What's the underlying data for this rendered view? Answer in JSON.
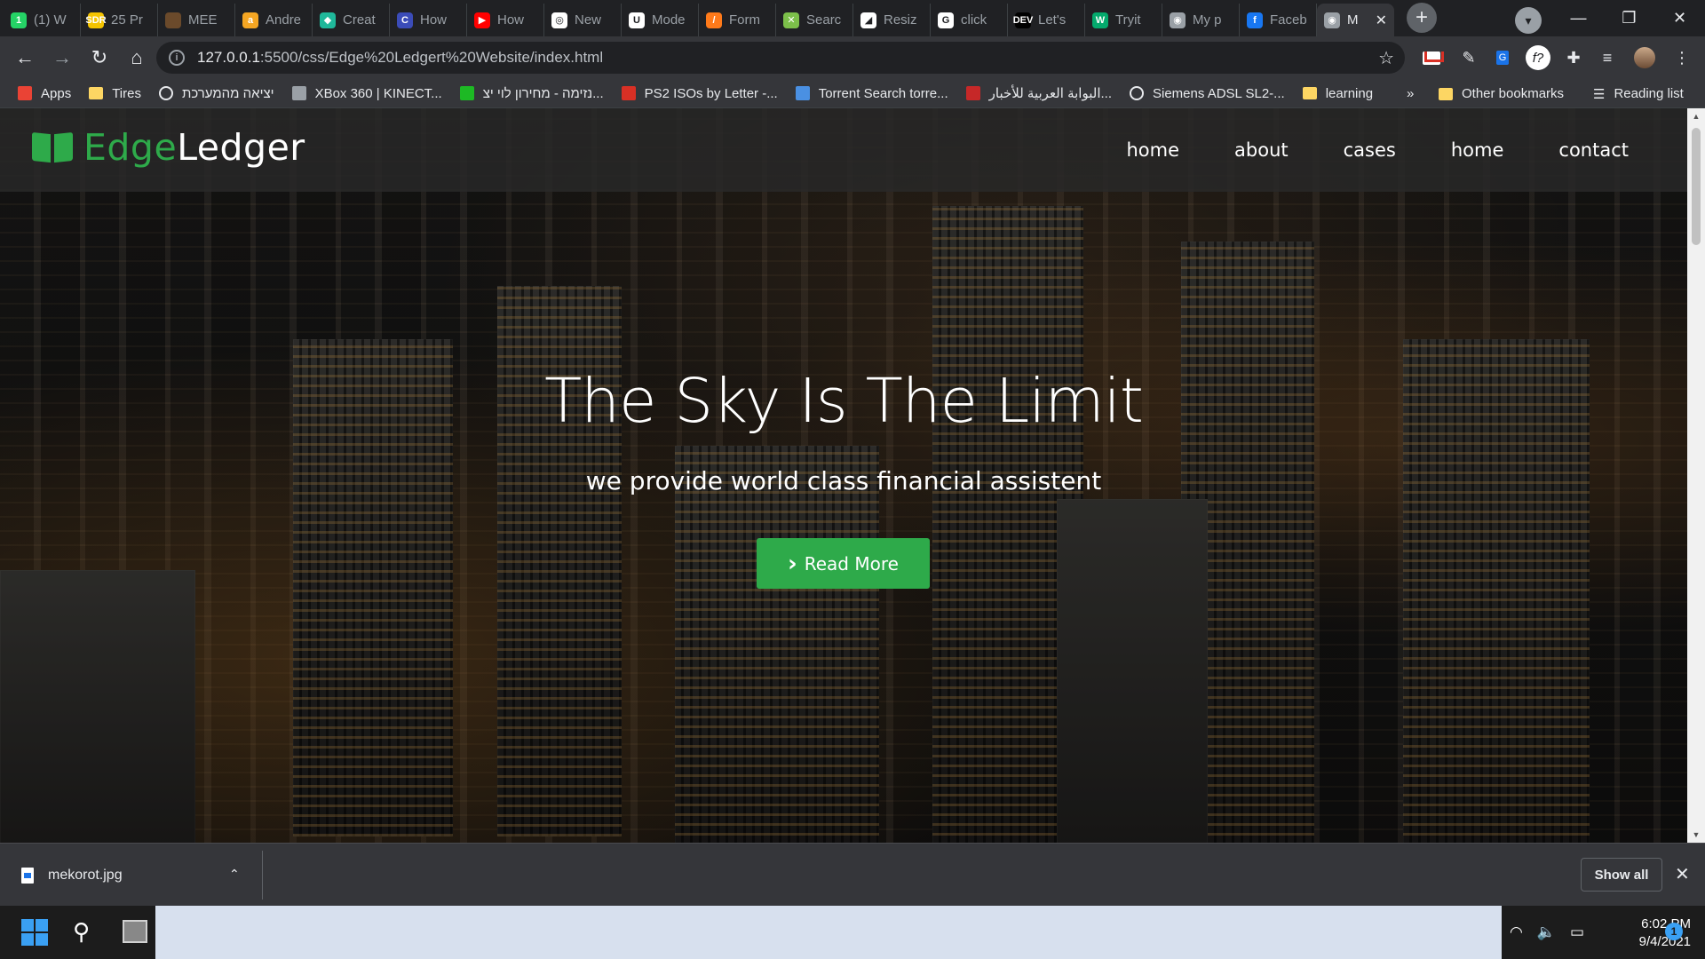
{
  "browser": {
    "tabs": [
      {
        "title": "(1) W",
        "color": "#25d366",
        "glyph": "1"
      },
      {
        "title": "25 Pr",
        "color": "#f5c400",
        "glyph": "SDR"
      },
      {
        "title": "MEE",
        "color": "#6b4a2b",
        "glyph": ""
      },
      {
        "title": "Andre",
        "color": "#f5a623",
        "glyph": "a"
      },
      {
        "title": "Creat",
        "color": "#1fb89a",
        "glyph": "◆"
      },
      {
        "title": "How",
        "color": "#3b4cb8",
        "glyph": "C"
      },
      {
        "title": "How",
        "color": "#ff0000",
        "glyph": "▶"
      },
      {
        "title": "New",
        "color": "#ffffff",
        "glyph": "◎"
      },
      {
        "title": "Mode",
        "color": "#ffffff",
        "glyph": "U"
      },
      {
        "title": "Form",
        "color": "#ff7a1a",
        "glyph": "/"
      },
      {
        "title": "Searc",
        "color": "#7cbf4a",
        "glyph": "✕"
      },
      {
        "title": "Resiz",
        "color": "#ffffff",
        "glyph": "◢"
      },
      {
        "title": "click",
        "color": "#ffffff",
        "glyph": "G"
      },
      {
        "title": "Let's",
        "color": "#000000",
        "glyph": "DEV"
      },
      {
        "title": "Tryit",
        "color": "#04aa6d",
        "glyph": "W"
      },
      {
        "title": "My p",
        "color": "#9aa0a6",
        "glyph": "◉"
      },
      {
        "title": "Faceb",
        "color": "#1877f2",
        "glyph": "f"
      },
      {
        "title": "M",
        "color": "#9aa0a6",
        "glyph": "◉",
        "active": true
      }
    ],
    "new_tab_glyph": "+",
    "window_controls": {
      "minimize": "—",
      "restore": "❐",
      "close": "✕"
    },
    "url": {
      "host": "127.0.0.1",
      "path": ":5500/css/Edge%20Ledgert%20Website/index.html"
    },
    "nav": {
      "back": "←",
      "forward": "→",
      "reload": "↻",
      "home": "⌂"
    },
    "bookmarks": [
      {
        "label": "Apps",
        "icon": "apps-icon",
        "color": "#ea4335"
      },
      {
        "label": "Tires",
        "icon": "folder-icon",
        "color": "#fdd663"
      },
      {
        "label": "יציאה מהמערכת",
        "icon": "globe-icon",
        "color": "#e8eaed"
      },
      {
        "label": "XBox 360 | KINECT...",
        "icon": "ex-icon",
        "color": "#9aa0a6"
      },
      {
        "label": "נזימה - מחירון לוי יצ...",
        "icon": "nz-icon",
        "color": "#1db924"
      },
      {
        "label": "PS2 ISOs by Letter -...",
        "icon": "mushroom-icon",
        "color": "#d93025"
      },
      {
        "label": "Torrent Search torre...",
        "icon": "t-icon",
        "color": "#4a90e2"
      },
      {
        "label": "البوابة العربية للأخبار...",
        "icon": "flag-icon",
        "color": "#c62828"
      },
      {
        "label": "Siemens ADSL SL2-...",
        "icon": "globe-icon",
        "color": "#e8eaed"
      },
      {
        "label": "learning",
        "icon": "folder-icon",
        "color": "#fdd663"
      }
    ],
    "bookmarks_more": "»",
    "other_bookmarks": "Other bookmarks",
    "reading_list": "Reading list"
  },
  "site": {
    "brand_part1": "Edge",
    "brand_part2": "Ledger",
    "menu": [
      "home",
      "about",
      "cases",
      "home",
      "contact"
    ],
    "hero_title": "The Sky Is The Limit",
    "hero_subtitle": "we provide world class financial assistent",
    "cta_label": "Read More",
    "cta_icon": "›",
    "accent_color": "#2eaa4a"
  },
  "downloads": {
    "file_name": "mekorot.jpg",
    "show_all": "Show all",
    "close": "✕",
    "chevron": "⌃"
  },
  "taskbar": {
    "time": "6:02 PM",
    "date": "9/4/2021",
    "notification_count": "1"
  }
}
